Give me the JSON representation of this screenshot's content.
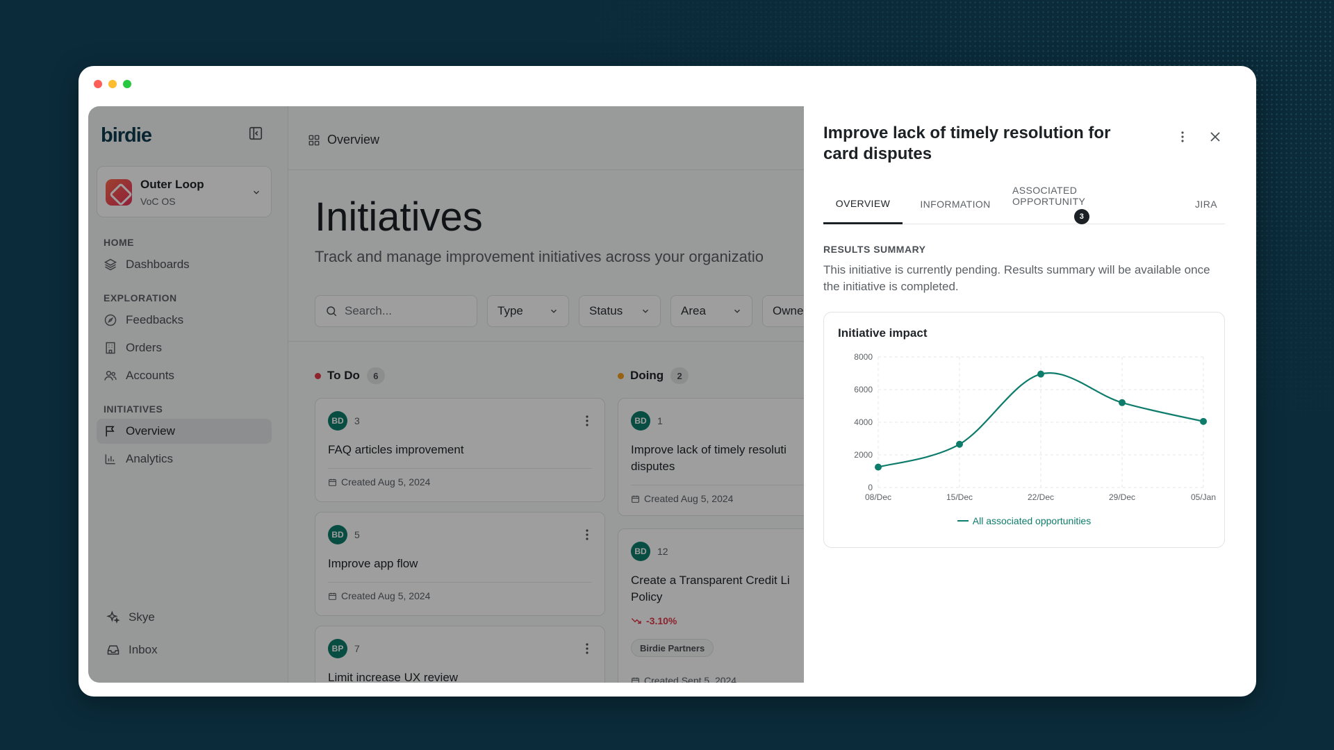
{
  "colors": {
    "brand": "#0c3b4e",
    "accent": "#0e7c6b",
    "todo": "#e63946",
    "doing": "#f4a020",
    "negative": "#e0394a"
  },
  "sidebar": {
    "logo": "birdie",
    "org": {
      "name": "Outer Loop",
      "sub": "VoC OS"
    },
    "sections": [
      {
        "label": "HOME",
        "items": [
          {
            "label": "Dashboards",
            "icon": "layers-icon"
          }
        ]
      },
      {
        "label": "EXPLORATION",
        "items": [
          {
            "label": "Feedbacks",
            "icon": "compass-icon"
          },
          {
            "label": "Orders",
            "icon": "building-icon"
          },
          {
            "label": "Accounts",
            "icon": "users-icon"
          }
        ]
      },
      {
        "label": "INITIATIVES",
        "items": [
          {
            "label": "Overview",
            "icon": "flag-icon",
            "active": true
          },
          {
            "label": "Analytics",
            "icon": "bar-chart-icon"
          }
        ]
      }
    ],
    "bottom": [
      {
        "label": "Skye",
        "icon": "sparkles-icon"
      },
      {
        "label": "Inbox",
        "icon": "inbox-icon"
      }
    ]
  },
  "main": {
    "breadcrumb": "Overview",
    "title": "Initiatives",
    "subtitle": "Track and manage improvement initiatives across your organizatio",
    "search_placeholder": "Search...",
    "filters": [
      "Type",
      "Status",
      "Area",
      "Owne"
    ],
    "columns": [
      {
        "name": "To Do",
        "count": "6",
        "cards": [
          {
            "avatar": "BD",
            "num": "3",
            "title": "FAQ articles improvement",
            "date": "Created Aug 5, 2024"
          },
          {
            "avatar": "BD",
            "num": "5",
            "title": "Improve app flow",
            "date": "Created Aug 5, 2024"
          },
          {
            "avatar": "BP",
            "num": "7",
            "title": "Limit increase UX review"
          }
        ]
      },
      {
        "name": "Doing",
        "count": "2",
        "cards": [
          {
            "avatar": "BD",
            "num": "1",
            "title_l1": "Improve lack of timely resoluti",
            "title_l2": "disputes",
            "date": "Created Aug 5, 2024"
          },
          {
            "avatar": "BD",
            "num": "12",
            "title_l1": "Create a Transparent Credit Li",
            "title_l2": "Policy",
            "trend": "-3.10%",
            "tag": "Birdie Partners",
            "date": "Created Sept 5, 2024"
          }
        ]
      }
    ]
  },
  "panel": {
    "title": "Improve lack of timely resolution for card disputes",
    "tabs": [
      {
        "label": "OVERVIEW",
        "active": true
      },
      {
        "label": "INFORMATION"
      },
      {
        "label": "ASSOCIATED OPPORTUNITY",
        "badge": "3"
      },
      {
        "label": "JIRA"
      }
    ],
    "results_label": "RESULTS SUMMARY",
    "results_text": "This initiative is currently pending. Results summary will be available once the initiative is completed."
  },
  "chart_data": {
    "type": "line",
    "title": "Initiative impact",
    "categories": [
      "08/Dec",
      "15/Dec",
      "22/Dec",
      "29/Dec",
      "05/Jan"
    ],
    "series": [
      {
        "name": "All associated opportunities",
        "values": [
          1250,
          2650,
          6950,
          5200,
          4050
        ]
      }
    ],
    "yticks": [
      0,
      2000,
      4000,
      6000,
      8000
    ],
    "ylim": [
      0,
      8000
    ],
    "grid": true,
    "legend": "bottom"
  }
}
